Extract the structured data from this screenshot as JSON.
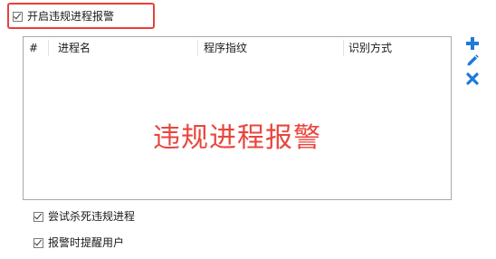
{
  "alarm_toggle": {
    "label": "开启违规进程报警",
    "checked": true
  },
  "process_table": {
    "columns": [
      "#",
      "进程名",
      "程序指纹",
      "识别方式"
    ],
    "rows": [],
    "overlay_text": "违规进程报警"
  },
  "toolbar": {
    "add_icon": "plus-icon",
    "edit_icon": "pencil-icon",
    "delete_icon": "x-icon",
    "icon_color": "#1e7ad8"
  },
  "options": [
    {
      "label": "尝试杀死违规进程",
      "checked": true
    },
    {
      "label": "报警时提醒用户",
      "checked": true
    }
  ],
  "colors": {
    "highlight": "#e8403a",
    "overlay_text": "#e8463d"
  }
}
